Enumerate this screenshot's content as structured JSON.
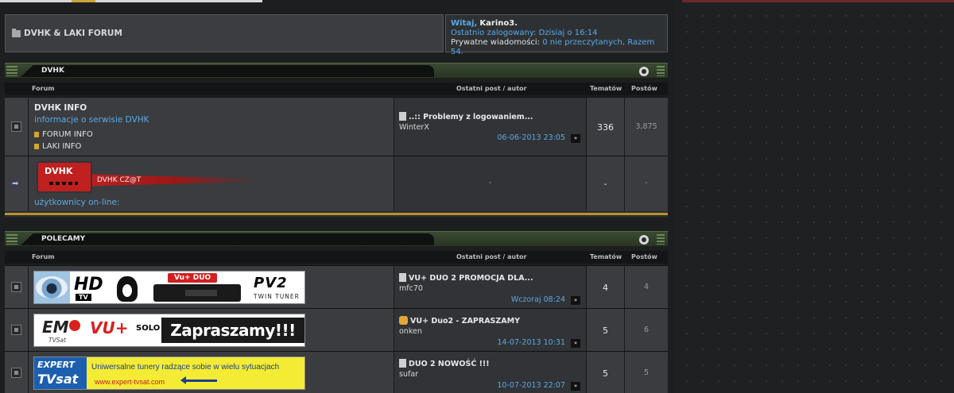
{
  "header": {
    "forum_title": "DVHK & LAKI FORUM",
    "welcome": "Witaj,",
    "username": "Karino3.",
    "last_login_label": "Ostatnio zalogowany:",
    "last_login_value": "Dzisiaj o 16:14",
    "pm_label": "Prywatne wiadomości:",
    "pm_value": "0 nie przeczytanych, Razem 54."
  },
  "columns": {
    "forum": "Forum",
    "last_post": "Ostatni post / autor",
    "topics": "Tematów",
    "posts": "Postów"
  },
  "categories": [
    {
      "name": "DVHK",
      "rows": [
        {
          "title": "DVHK INFO",
          "desc": "informacje o serwisie DVHK",
          "subforums": [
            "FORUM INFO",
            "LAKI INFO"
          ],
          "last_title": "..:: Problemy z logowaniem...",
          "last_author": "WinterX",
          "last_date": "06-06-2013 23:05",
          "topics": "336",
          "posts": "3,875"
        },
        {
          "logo_text": "DVHK",
          "banner_text": "DVHK CZ@T",
          "desc": "użytkownicy on-line:",
          "last_post": "-",
          "topics": "-",
          "posts": "-"
        }
      ]
    },
    {
      "name": "POLECAMY",
      "rows": [
        {
          "banner": {
            "hd": "HD",
            "tv": "TV",
            "vuduo": "Vu+ DUO",
            "pv2": "PV2",
            "twin": "TWIN TUNER"
          },
          "last_title": "VU+ DUO 2 PROMOCJA DLA...",
          "last_author": "mfc70",
          "last_date": "Wczoraj 08:24",
          "topics": "4",
          "posts": "4"
        },
        {
          "banner": {
            "em": "EM",
            "tvsat": "TVSat",
            "vu": "VU+",
            "solo": "SOLO",
            "zap": "Zapraszamy!!!"
          },
          "last_title": "VU+ Duo2 - ZAPRASZAMY",
          "last_author": "onken",
          "last_date": "14-07-2013 10:31",
          "topics": "5",
          "posts": "6"
        },
        {
          "banner": {
            "expert": "EXPERT",
            "tvs": "TVsat",
            "tag": "Uniwersalne tunery radzące sobie w wielu sytuacjach",
            "url": "www.expert-tvsat.com"
          },
          "last_title": "DUO 2 NOWOŚĆ !!!",
          "last_author": "sufar",
          "last_date": "10-07-2013 22:07",
          "topics": "5",
          "posts": "5"
        }
      ]
    }
  ],
  "go_glyph": "»",
  "colors": {
    "link": "#5aa9e6",
    "gold": "#b7922f",
    "category_bar": "#3a4a32"
  }
}
